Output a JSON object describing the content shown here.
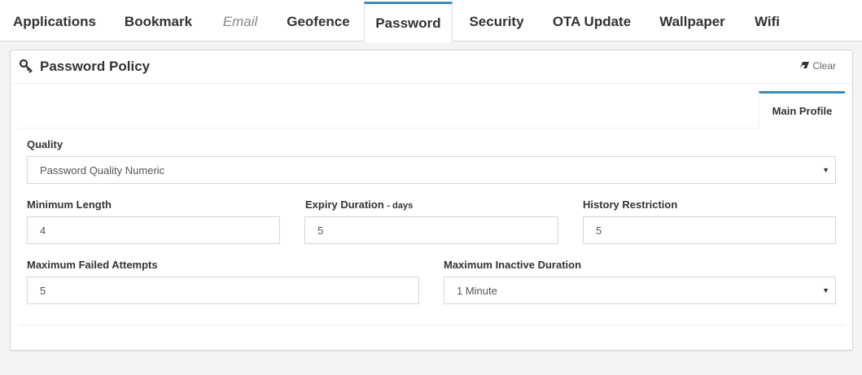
{
  "tabs": [
    {
      "label": "Applications"
    },
    {
      "label": "Bookmark"
    },
    {
      "label": "Email"
    },
    {
      "label": "Geofence"
    },
    {
      "label": "Password"
    },
    {
      "label": "Security"
    },
    {
      "label": "OTA Update"
    },
    {
      "label": "Wallpaper"
    },
    {
      "label": "Wifi"
    }
  ],
  "panel": {
    "title": "Password Policy",
    "clear_label": "Clear",
    "inner_tab": "Main Profile"
  },
  "form": {
    "quality": {
      "label": "Quality",
      "value": "Password Quality Numeric"
    },
    "min_length": {
      "label": "Minimum Length",
      "value": "4"
    },
    "expiry": {
      "label": "Expiry Duration",
      "unit": "- days",
      "value": "5"
    },
    "history": {
      "label": "History Restriction",
      "value": "5"
    },
    "max_failed": {
      "label": "Maximum Failed Attempts",
      "value": "5"
    },
    "max_inactive": {
      "label": "Maximum Inactive Duration",
      "value": "1 Minute"
    }
  },
  "colors": {
    "accent": "#3c8dbc"
  }
}
